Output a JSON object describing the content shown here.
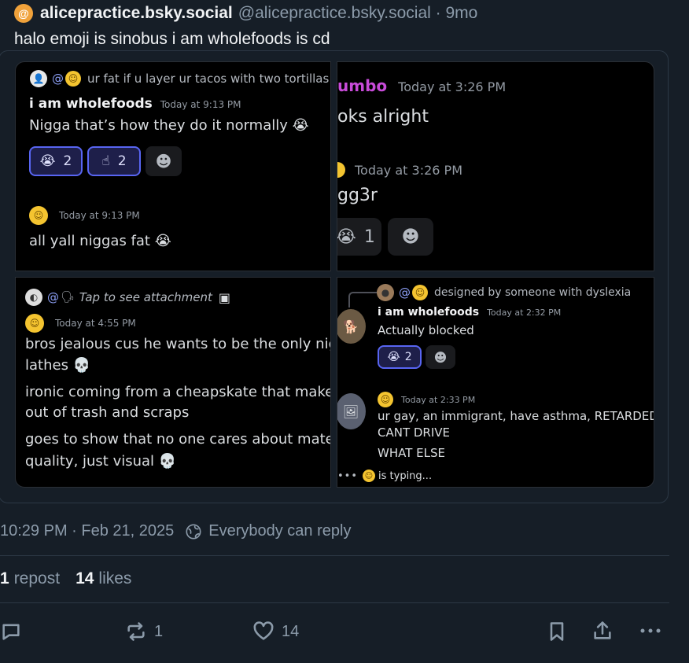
{
  "post": {
    "display_name": "alicepractice.bsky.social",
    "handle": "@alicepractice.bsky.social · 9mo",
    "text": "halo emoji is sinobus i am wholefoods is cd",
    "timestamp": "10:29 PM · Feb 21, 2025",
    "reply_setting": "Everybody can reply"
  },
  "stats": {
    "reposts_count": "1",
    "reposts_label": "repost",
    "likes_count": "14",
    "likes_label": "likes"
  },
  "actions": {
    "repost_count": "1",
    "like_count": "14"
  },
  "panel1": {
    "reply_text": "ur fat if u layer ur tacos with two tortillas",
    "user1": "i am wholefoods",
    "ts1": "Today at 9:13 PM",
    "msg1": "Nigga that’s how they do it normally 😭",
    "react1": "2",
    "react2": "2",
    "ts2": "Today at 9:13 PM",
    "msg2": "all yall niggas fat 😭"
  },
  "panel2": {
    "user1": "umbo",
    "ts1": "Today at 3:26 PM",
    "msg1": "oks alright",
    "ts2": "Today at 3:26 PM",
    "msg2": "gg3r",
    "react1": "1"
  },
  "panel3": {
    "reply_text": "Tap to see attachment",
    "ts1": "Today at 4:55 PM",
    "msg1a": "bros jealous cus he wants to be the only nigga",
    "msg1b": "lathes 💀",
    "msg2a": "ironic coming from a cheapskate that makes t",
    "msg2b": "out of trash and scraps",
    "msg3a": "goes to show that no one cares about materia",
    "msg3b": "quality, just visual 💀"
  },
  "panel4": {
    "reply_text": "designed by someone with dyslexia",
    "user1": "i am wholefoods",
    "ts1": "Today at 2:32 PM",
    "msg1": "Actually blocked",
    "react1": "2",
    "ts2": "Today at 2:33 PM",
    "msg2a": "ur gay, an immigrant, have asthma, RETARDED,",
    "msg2b": "CANT DRIVE",
    "msg3": "WHAT ELSE",
    "typing": "is typing..."
  },
  "icons": {
    "avatar_letter": "@"
  },
  "colors": {
    "background": "#161e27",
    "discord_black": "#000000",
    "reaction_blue": "#5865f2",
    "mention": "#8c9ff5",
    "accent_orange": "#f0a23b"
  }
}
